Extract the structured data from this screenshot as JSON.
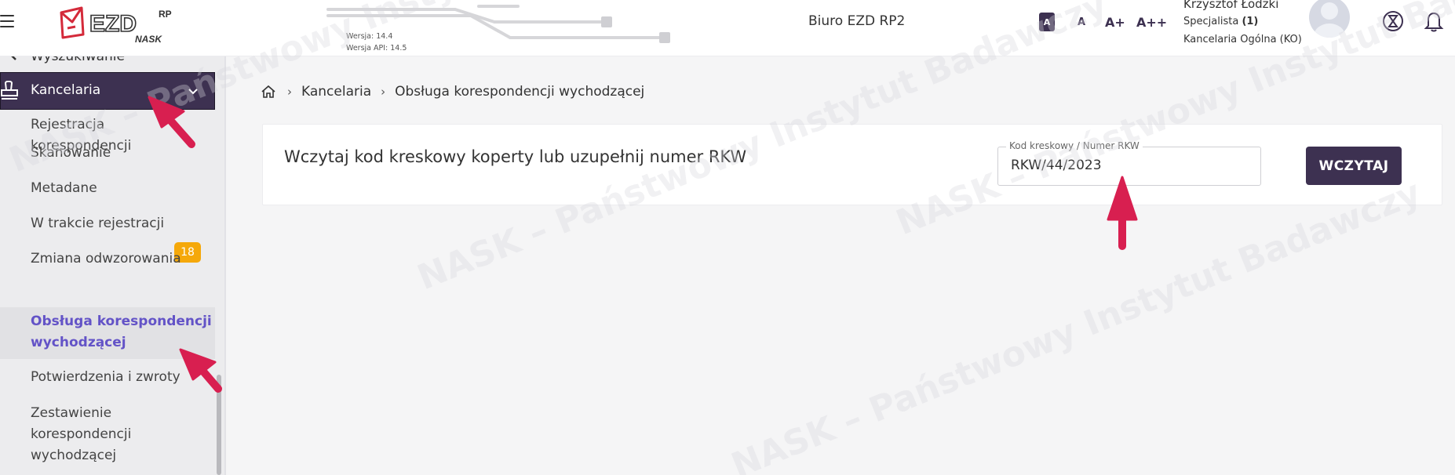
{
  "header": {
    "logo": {
      "brand": "EZD",
      "sup": "RP",
      "org": "NASK"
    },
    "version": {
      "app": "Wersja: 14.4",
      "api": "Wersja API: 14.5"
    },
    "office_title": "Biuro EZD RP2",
    "font_buttons": [
      "A",
      "A",
      "A+",
      "A++"
    ],
    "user": {
      "name": "Krzysztof Łodzki",
      "role": "Specjalista",
      "role_count": "(1)",
      "department": "Kancelaria Ogólna (KO)"
    },
    "icons": [
      "menu-icon",
      "avatar",
      "hourglass-icon",
      "bell-icon"
    ]
  },
  "sidebar": {
    "search_label": "Wyszukiwanie",
    "section": {
      "label": "Kancelaria"
    },
    "items": [
      {
        "label": "Rejestracja korespondencji"
      },
      {
        "label": "Skanowanie"
      },
      {
        "label": "Metadane"
      },
      {
        "label": "W trakcie rejestracji",
        "badge": "18"
      },
      {
        "label": "Zmiana odwzorowania"
      },
      {
        "label": "Obsługa korespondencji wychodzącej",
        "active": true
      },
      {
        "label": "Potwierdzenia i zwroty"
      },
      {
        "label": "Zestawienie korespondencji wychodzącej"
      }
    ]
  },
  "breadcrumb": {
    "items": [
      "Kancelaria",
      "Obsługa korespondencji wychodzącej"
    ]
  },
  "card": {
    "title": "Wczytaj kod kreskowy koperty lub uzupełnij numer RKW",
    "field_label": "Kod kreskowy / Numer RKW",
    "field_value": "RKW/44/2023",
    "button_label": "WCZYTAJ"
  },
  "watermark_text": "NASK – Państwowy Instytut Badawczy",
  "colors": {
    "primary": "#3d3151",
    "active_text": "#6353c7",
    "badge": "#f5a80a",
    "arrow": "#d81f50",
    "logo_red": "#d42a3a"
  }
}
